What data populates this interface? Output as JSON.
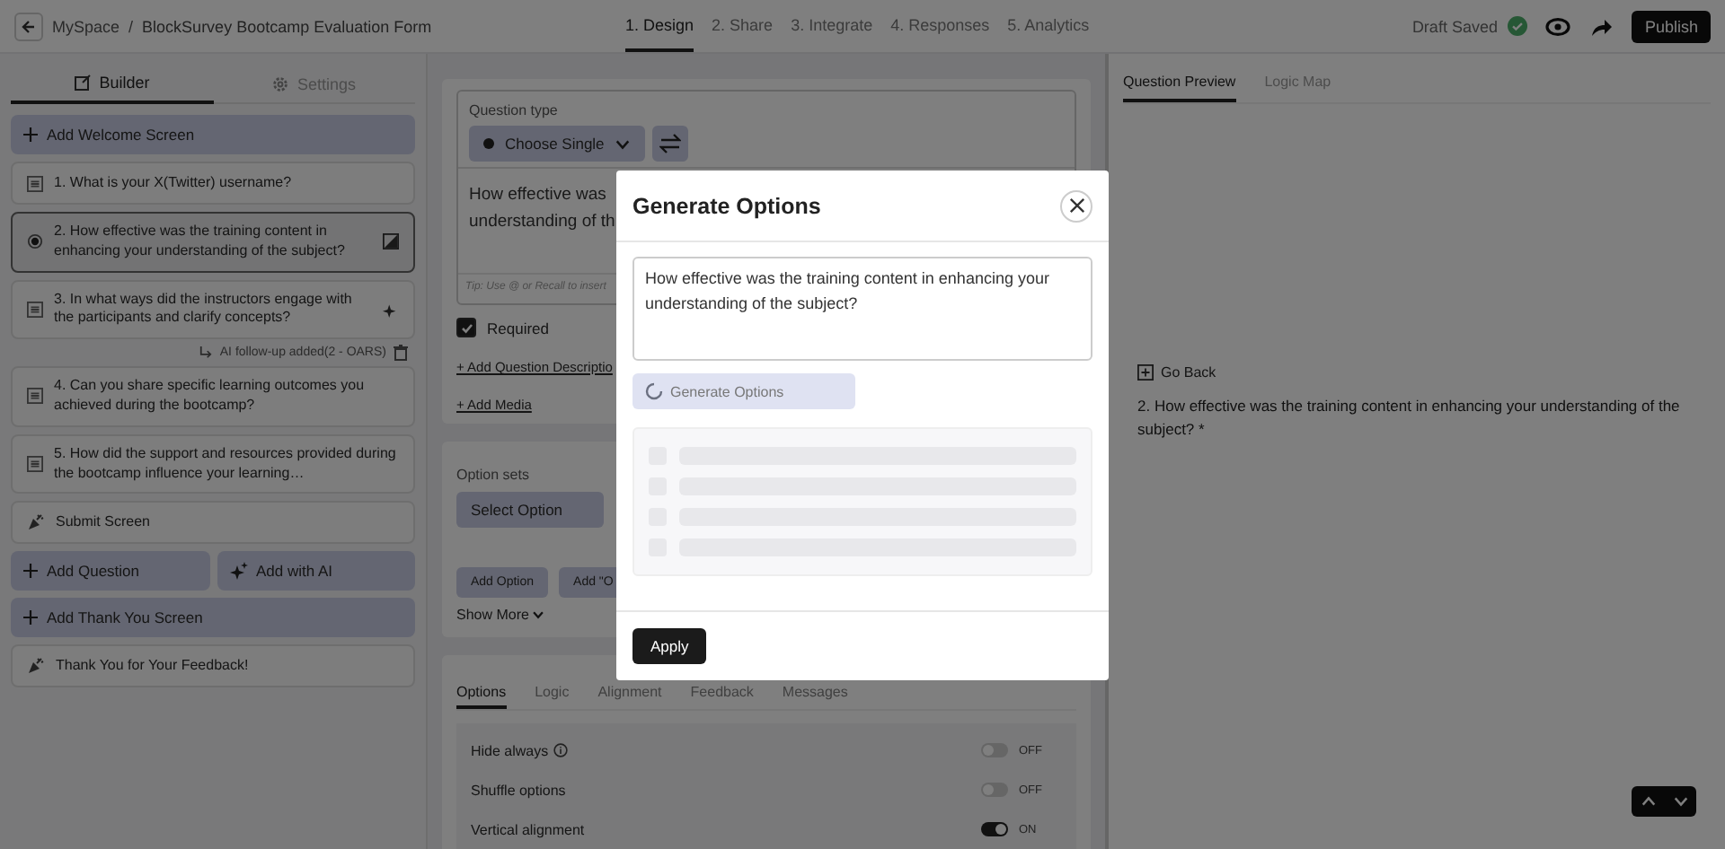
{
  "header": {
    "breadcrumb_root": "MySpace",
    "separator": "/",
    "form_title": "BlockSurvey Bootcamp Evaluation Form",
    "steps": [
      {
        "label": "1. Design",
        "selected": true
      },
      {
        "label": "2. Share",
        "selected": false
      },
      {
        "label": "3. Integrate",
        "selected": false
      },
      {
        "label": "4. Responses",
        "selected": false
      },
      {
        "label": "5. Analytics",
        "selected": false
      }
    ],
    "save_status": "Draft Saved",
    "publish": "Publish"
  },
  "builder": {
    "tabs": [
      {
        "label": "Builder",
        "selected": true
      },
      {
        "label": "Settings",
        "selected": false
      }
    ],
    "items": [
      {
        "kind": "action",
        "label": "Add Welcome Screen"
      },
      {
        "kind": "question",
        "label": "1. What is your X(Twitter) username?",
        "selected": false
      },
      {
        "kind": "question",
        "label": "2. How effective was the training content in enhancing your understanding of the subject?",
        "selected": true
      },
      {
        "kind": "question",
        "label": "3. In what ways did the instructors engage with the participants and clarify concepts?",
        "selected": false,
        "note": "AI follow-up added(2 - OARS)"
      },
      {
        "kind": "question",
        "label": "4. Can you share specific learning outcomes you achieved during the bootcamp?",
        "selected": false
      },
      {
        "kind": "question",
        "label": "5. How did the support and resources provided during the bootcamp influence your learning…",
        "selected": false
      },
      {
        "kind": "screen",
        "label": "Submit Screen"
      },
      {
        "kind": "action-pair",
        "label": "Add Question",
        "second": "Add with AI"
      },
      {
        "kind": "action",
        "label": "Add Thank You Screen"
      },
      {
        "kind": "screen",
        "label": "Thank You for Your Feedback!"
      }
    ]
  },
  "editor": {
    "type_label": "Question type",
    "type_value": "Choose Single",
    "question_lines": [
      "How effective was",
      "understanding of th"
    ],
    "tip": "Tip: Use @ or Recall to insert",
    "required": {
      "label": "Required",
      "checked": true
    },
    "add_description": "+ Add Question Descriptio",
    "add_media": "+ Add Media",
    "option_sets_label": "Option sets",
    "option_sets_value": "Select Option",
    "add_option": "Add Option",
    "add_other": "Add \"O",
    "show_more": "Show More",
    "tabs": [
      {
        "label": "Options",
        "selected": true
      },
      {
        "label": "Logic",
        "selected": false
      },
      {
        "label": "Alignment",
        "selected": false
      },
      {
        "label": "Feedback",
        "selected": false
      },
      {
        "label": "Messages",
        "selected": false
      }
    ],
    "settings": [
      {
        "label": "Hide always",
        "info": true,
        "on": false,
        "state": "OFF"
      },
      {
        "label": "Shuffle options",
        "info": false,
        "on": false,
        "state": "OFF"
      },
      {
        "label": "Vertical alignment",
        "info": false,
        "on": true,
        "state": "ON"
      }
    ]
  },
  "preview": {
    "tabs": [
      {
        "label": "Question Preview",
        "selected": true
      },
      {
        "label": "Logic Map",
        "selected": false
      }
    ],
    "go_back": "Go Back",
    "question_lines": [
      "2. How effective was the training content in enhancing your understanding of the",
      "subject? *"
    ]
  },
  "modal": {
    "title": "Generate Options",
    "prompt": "How effective was the training content in enhancing your understanding of the subject?",
    "generate": "Generate Options",
    "loading": true,
    "apply": "Apply"
  }
}
